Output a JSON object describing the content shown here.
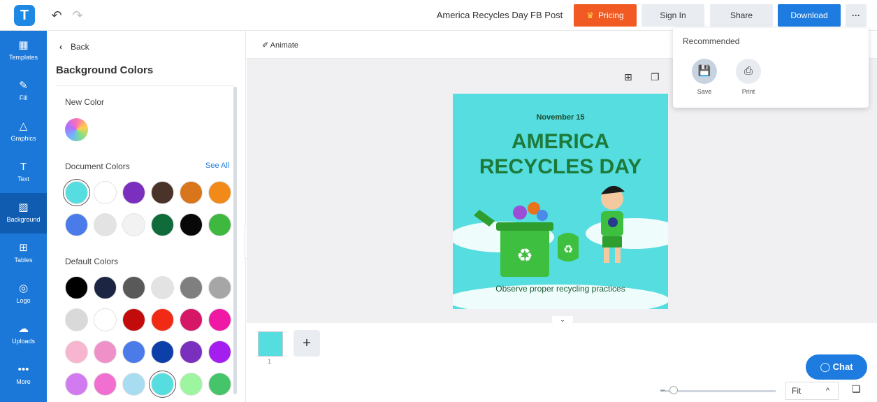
{
  "header": {
    "logo_letter": "T",
    "undo_icon": "↶",
    "redo_icon": "↷",
    "doc_title": "America Recycles Day FB Post",
    "pricing_label": "Pricing",
    "signin_label": "Sign In",
    "share_label": "Share",
    "download_label": "Download",
    "more_label": "···"
  },
  "rail": {
    "items": [
      {
        "label": "Templates",
        "icon": "▦"
      },
      {
        "label": "Fill",
        "icon": "✎"
      },
      {
        "label": "Graphics",
        "icon": "△"
      },
      {
        "label": "Text",
        "icon": "T"
      },
      {
        "label": "Background",
        "icon": "▨"
      },
      {
        "label": "Tables",
        "icon": "⊞"
      },
      {
        "label": "Logo",
        "icon": "◎"
      },
      {
        "label": "Uploads",
        "icon": "☁"
      },
      {
        "label": "More",
        "icon": "•••"
      }
    ],
    "active": "Background"
  },
  "panel": {
    "back_label": "Back",
    "title": "Background Colors",
    "new_color_label": "New Color",
    "document_colors_label": "Document Colors",
    "see_all_label": "See All",
    "default_colors_label": "Default Colors",
    "document_colors": [
      "#55dde0",
      "#ffffff",
      "#7b2fbe",
      "#4a3328",
      "#d9751b",
      "#f28a1a",
      "#4a7be8",
      "#e3e3e3",
      "#f2f2f2",
      "#0f6b3a",
      "#080808",
      "#3fb83f"
    ],
    "default_colors": [
      "#000000",
      "#1c2542",
      "#595959",
      "#e3e3e3",
      "#7f7f7f",
      "#a6a6a6",
      "#d9d9d9",
      "#ffffff",
      "#c20b0b",
      "#f02a14",
      "#d61667",
      "#f019a6",
      "#f7b5cf",
      "#f090c8",
      "#4a7be8",
      "#0c3fa8",
      "#7b2fbe",
      "#a51ef0",
      "#d27af0",
      "#f06fd0",
      "#a8dcf0",
      "#55dde0",
      "#9ef5a0",
      "#45c46a"
    ]
  },
  "toolbar": {
    "animate_label": "Animate"
  },
  "design": {
    "date": "November 15",
    "title_line1": "AMERICA",
    "title_line2": "RECYCLES DAY",
    "subtitle": "Observe proper recycling practices"
  },
  "pages": {
    "thumb_number": "1",
    "add_label": "+"
  },
  "dropdown": {
    "title": "Recommended",
    "save_label": "Save",
    "print_label": "Print"
  },
  "bottom": {
    "chat_label": "Chat",
    "zoom_label": "Fit",
    "zoom_caret": "^"
  }
}
